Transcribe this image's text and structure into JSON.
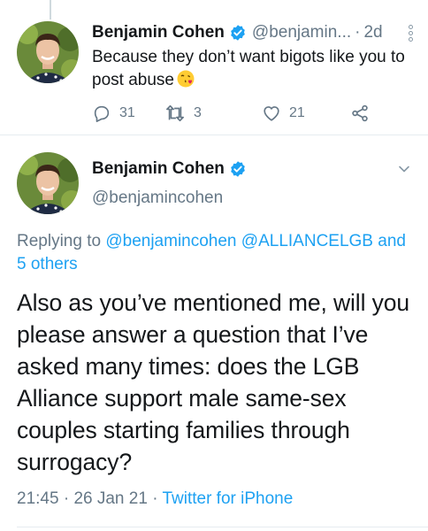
{
  "tweet1": {
    "name": "Benjamin Cohen",
    "handle": "@benjamin...",
    "separator": "·",
    "time": "2d",
    "text": "Because they don’t want bigots like you to post abuse",
    "emoji": "face-blowing-a-kiss",
    "actions": {
      "reply_count": "31",
      "retweet_count": "3",
      "like_count": "21"
    },
    "icons": {
      "reply": "reply-icon",
      "retweet": "retweet-icon",
      "like": "heart-icon",
      "share": "share-icon",
      "more": "more-vertical-icon",
      "verified": "verified-badge-icon"
    }
  },
  "tweet2": {
    "name": "Benjamin Cohen",
    "handle": "@benjamincohen",
    "replying_prefix": "Replying to",
    "replying_to": [
      "@benjamincohen",
      "@ALLIANCELGB"
    ],
    "replying_and": "and",
    "replying_others": "5 others",
    "text": "Also as you’ve mentioned me, will you please answer a question that I’ve asked many times: does the LGB Alliance support male same-sex couples starting families through surrogacy?",
    "time": "21:45",
    "date": "26 Jan 21",
    "source": "Twitter for iPhone",
    "separator": "·",
    "icons": {
      "verified": "verified-badge-icon",
      "menu": "chevron-down-icon"
    }
  },
  "colors": {
    "text": "#14171a",
    "secondary": "#657786",
    "accent": "#1da1f2",
    "divider": "#e6ecf0"
  }
}
